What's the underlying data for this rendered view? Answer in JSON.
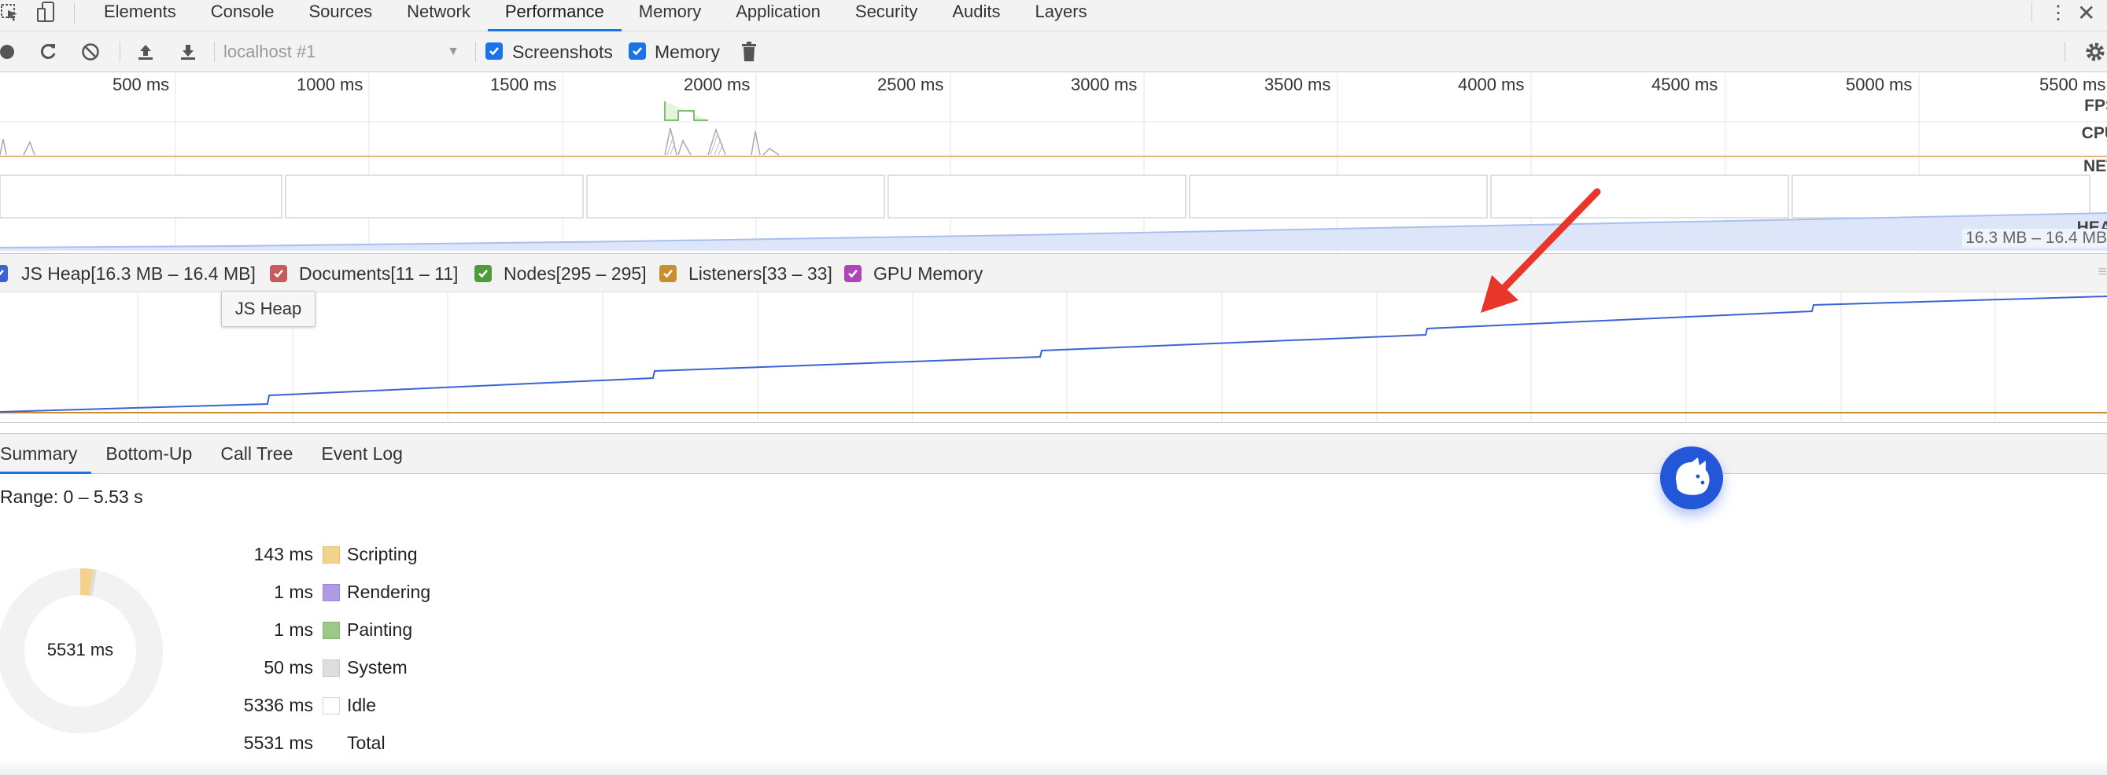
{
  "tabs": [
    {
      "label": "Elements"
    },
    {
      "label": "Console"
    },
    {
      "label": "Sources"
    },
    {
      "label": "Network"
    },
    {
      "label": "Performance",
      "active": true
    },
    {
      "label": "Memory"
    },
    {
      "label": "Application"
    },
    {
      "label": "Security"
    },
    {
      "label": "Audits"
    },
    {
      "label": "Layers"
    }
  ],
  "toolbar": {
    "target": "localhost #1",
    "screenshots_label": "Screenshots",
    "screenshots_checked": true,
    "memory_label": "Memory",
    "memory_checked": true
  },
  "overview": {
    "ruler": [
      "500 ms",
      "1000 ms",
      "1500 ms",
      "2000 ms",
      "2500 ms",
      "3000 ms",
      "3500 ms",
      "4000 ms",
      "4500 ms",
      "5000 ms",
      "5500 ms"
    ],
    "tracks": {
      "fps": "FPS",
      "cpu": "CPU",
      "net": "NET",
      "heap": "HEAP"
    },
    "heap_range": "16.3 MB – 16.4 MB"
  },
  "counters": [
    {
      "label": "JS Heap[16.3 MB – 16.4 MB]",
      "color": "#3b63d4",
      "checked": true
    },
    {
      "label": "Documents[11 – 11]",
      "color": "#c75b5b",
      "checked": true
    },
    {
      "label": "Nodes[295 – 295]",
      "color": "#4e9b3b",
      "checked": true
    },
    {
      "label": "Listeners[33 – 33]",
      "color": "#c98f2d",
      "checked": true
    },
    {
      "label": "GPU Memory",
      "color": "#b045b9",
      "checked": true
    }
  ],
  "tooltip": "JS Heap",
  "bottom_tabs": [
    {
      "label": "Summary",
      "active": true
    },
    {
      "label": "Bottom-Up"
    },
    {
      "label": "Call Tree"
    },
    {
      "label": "Event Log"
    }
  ],
  "summary": {
    "range": "Range: 0 – 5.53 s",
    "total_center": "5531 ms",
    "rows": [
      {
        "value": "143 ms",
        "label": "Scripting",
        "color": "#f2d28c"
      },
      {
        "value": "1 ms",
        "label": "Rendering",
        "color": "#af9ae6"
      },
      {
        "value": "1 ms",
        "label": "Painting",
        "color": "#9cc98a"
      },
      {
        "value": "50 ms",
        "label": "System",
        "color": "#dedede"
      },
      {
        "value": "5336 ms",
        "label": "Idle",
        "color": "#ffffff"
      },
      {
        "value": "5531 ms",
        "label": "Total",
        "color": ""
      }
    ]
  }
}
